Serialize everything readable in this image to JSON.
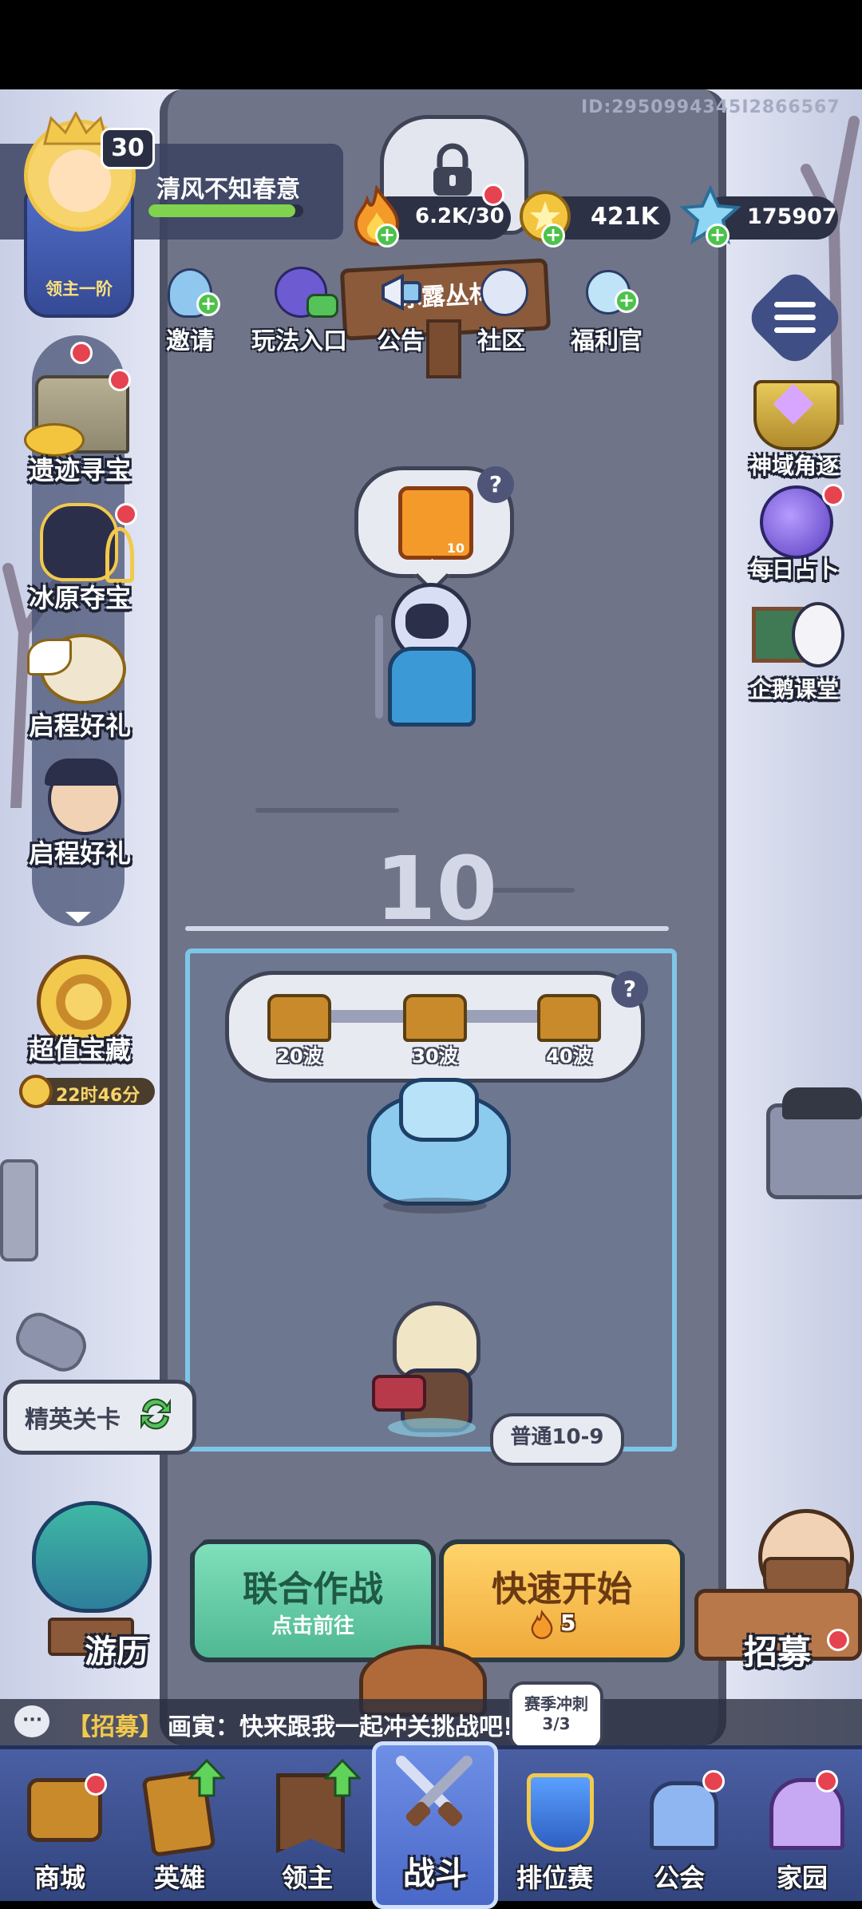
{
  "player": {
    "id": "ID:2950994345I2866567",
    "level": "30",
    "name": "清风不知春意",
    "rank": "领主一阶",
    "xp_fraction": 0.95
  },
  "resources": {
    "stamina": "6.2K/30",
    "gold": "421K",
    "crystal": "175907"
  },
  "top_menu": [
    {
      "label": "邀请",
      "icon": "penguin-invite-icon"
    },
    {
      "label": "玩法入口",
      "icon": "gamepad-monster-icon"
    },
    {
      "label": "公告",
      "icon": "megaphone-icon"
    },
    {
      "label": "社区",
      "icon": "community-icon"
    },
    {
      "label": "福利官",
      "icon": "gift-officer-icon"
    }
  ],
  "signpost": "冰露丛林",
  "left_events": [
    {
      "label": "遗迹寻宝",
      "icon": "ruins-icon"
    },
    {
      "label": "冰原夺宝",
      "icon": "anubis-icon"
    },
    {
      "label": "启程好礼",
      "icon": "griffin-icon"
    },
    {
      "label": "启程好礼",
      "icon": "character-icon"
    }
  ],
  "value_treasure": {
    "label": "超值宝藏",
    "timer": "22时46分"
  },
  "right_events": [
    {
      "label": "神域角逐"
    },
    {
      "label": "每日占卜"
    },
    {
      "label": "企鹅课堂"
    }
  ],
  "reward_bubble": {
    "count": "10",
    "help": "?"
  },
  "stage": {
    "number": "10",
    "waves": [
      "20波",
      "30波",
      "40波"
    ],
    "help": "?",
    "difficulty": "普通10-9"
  },
  "elite_stage": "精英关卡",
  "journey": "游历",
  "recruit": "招募",
  "buttons": {
    "coop_title": "联合作战",
    "coop_sub": "点击前往",
    "quick_title": "快速开始",
    "quick_cost": "5"
  },
  "chat": {
    "tag": "【招募】",
    "message": "画寅：快来跟我一起冲关挑战吧!"
  },
  "season_badge": {
    "title": "赛季冲刺",
    "progress": "3/3"
  },
  "bottom_nav": [
    {
      "label": "商城",
      "active": false
    },
    {
      "label": "英雄",
      "active": false
    },
    {
      "label": "领主",
      "active": false
    },
    {
      "label": "战斗",
      "active": true
    },
    {
      "label": "排位赛",
      "active": false
    },
    {
      "label": "公会",
      "active": false
    },
    {
      "label": "家园",
      "active": false
    }
  ],
  "colors": {
    "path": "#6f7489",
    "snow": "#e2e6f5",
    "coop_green": "#5fc9a4",
    "quick_orange": "#f2b84b",
    "nav_bg": "#3a4d8c"
  }
}
